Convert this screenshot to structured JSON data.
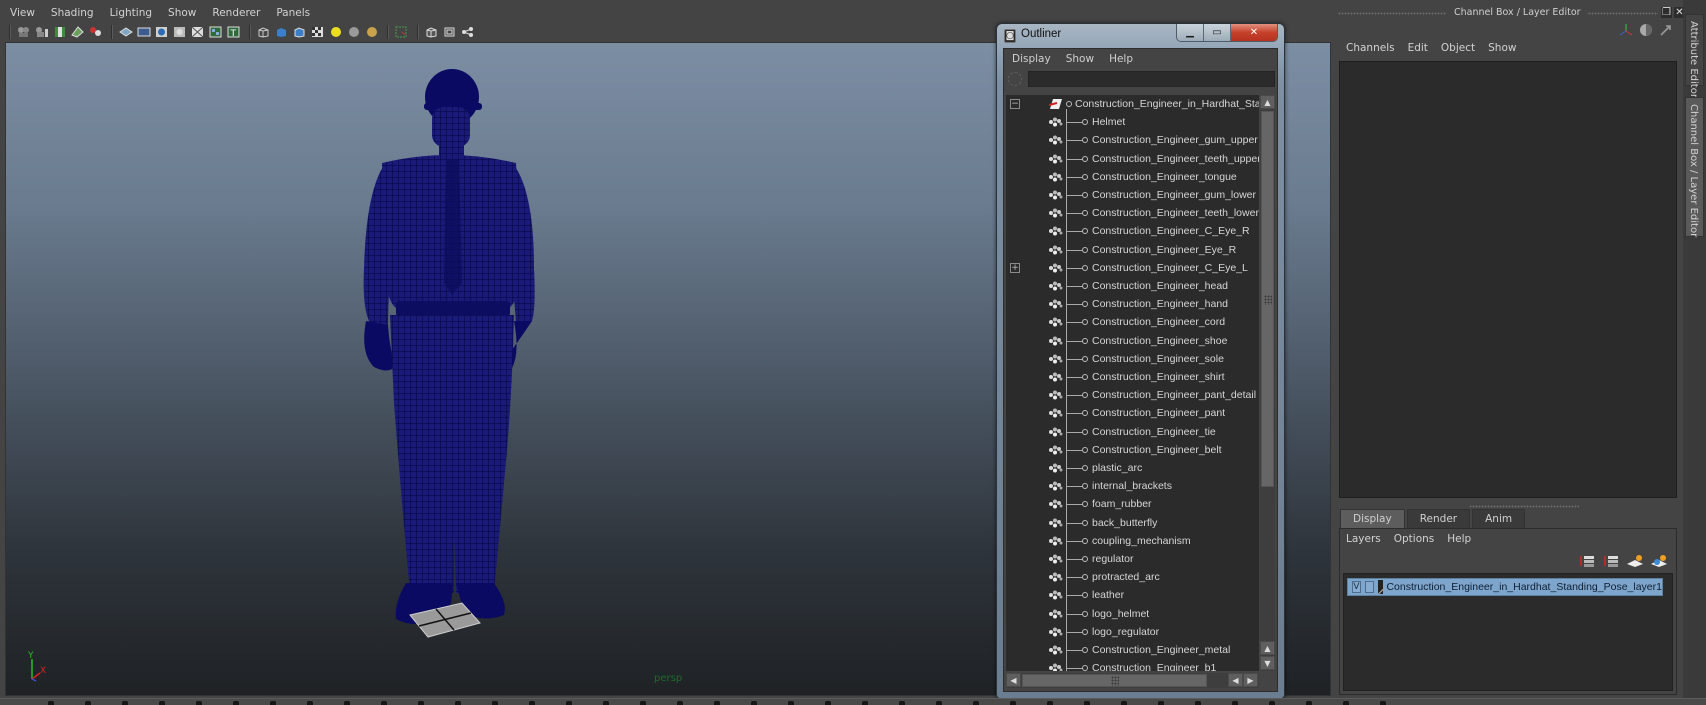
{
  "viewport": {
    "menu": [
      "View",
      "Shading",
      "Lighting",
      "Show",
      "Renderer",
      "Panels"
    ],
    "toolbar_icons": [
      "camera-select-icon",
      "camera-attributes-icon",
      "bookmark-icon",
      "image-plane-icon",
      "2d-pan-zoom-icon",
      "grid-icon",
      "film-gate-icon",
      "resolution-gate-icon",
      "gate-mask-icon",
      "field-chart-icon",
      "safe-action-icon",
      "safe-title-icon",
      "wireframe-icon",
      "smooth-shade-icon",
      "wireframe-on-shaded-icon",
      "textured-icon",
      "use-all-lights-icon",
      "shadows-icon",
      "ambient-occlusion-icon",
      "isolate-select-icon",
      "xray-icon",
      "xray-joints-icon",
      "xray-component-icon"
    ],
    "camera_label": "persp",
    "axis": {
      "y": "Y",
      "x": "X"
    },
    "wireframe_color": "#0a0a6e",
    "background_top": "#7c8ea3",
    "background_bottom": "#1f2225"
  },
  "outliner": {
    "title": "Outliner",
    "menu": [
      "Display",
      "Show",
      "Help"
    ],
    "search_value": "",
    "root": {
      "label": "Construction_Engineer_in_Hardhat_Standin",
      "expanded": true
    },
    "items": [
      {
        "label": "Helmet",
        "expandable": false
      },
      {
        "label": "Construction_Engineer_gum_upper",
        "expandable": false
      },
      {
        "label": "Construction_Engineer_teeth_upper",
        "expandable": false
      },
      {
        "label": "Construction_Engineer_tongue",
        "expandable": false
      },
      {
        "label": "Construction_Engineer_gum_lower",
        "expandable": false
      },
      {
        "label": "Construction_Engineer_teeth_lower",
        "expandable": false
      },
      {
        "label": "Construction_Engineer_C_Eye_R",
        "expandable": false
      },
      {
        "label": "Construction_Engineer_Eye_R",
        "expandable": false
      },
      {
        "label": "Construction_Engineer_C_Eye_L",
        "expandable": true
      },
      {
        "label": "Construction_Engineer_head",
        "expandable": false
      },
      {
        "label": "Construction_Engineer_hand",
        "expandable": false
      },
      {
        "label": "Construction_Engineer_cord",
        "expandable": false
      },
      {
        "label": "Construction_Engineer_shoe",
        "expandable": false
      },
      {
        "label": "Construction_Engineer_sole",
        "expandable": false
      },
      {
        "label": "Construction_Engineer_shirt",
        "expandable": false
      },
      {
        "label": "Construction_Engineer_pant_detail",
        "expandable": false
      },
      {
        "label": "Construction_Engineer_pant",
        "expandable": false
      },
      {
        "label": "Construction_Engineer_tie",
        "expandable": false
      },
      {
        "label": "Construction_Engineer_belt",
        "expandable": false
      },
      {
        "label": "plastic_arc",
        "expandable": false
      },
      {
        "label": "internal_brackets",
        "expandable": false
      },
      {
        "label": "foam_rubber",
        "expandable": false
      },
      {
        "label": "back_butterfly",
        "expandable": false
      },
      {
        "label": "coupling_mechanism",
        "expandable": false
      },
      {
        "label": "regulator",
        "expandable": false
      },
      {
        "label": "protracted_arc",
        "expandable": false
      },
      {
        "label": "leather",
        "expandable": false
      },
      {
        "label": "logo_helmet",
        "expandable": false
      },
      {
        "label": "logo_regulator",
        "expandable": false
      },
      {
        "label": "Construction_Engineer_metal",
        "expandable": false
      },
      {
        "label": "Construction_Engineer_b1",
        "expandable": false
      }
    ]
  },
  "channel_box": {
    "title": "Channel Box / Layer Editor",
    "menu": [
      "Channels",
      "Edit",
      "Object",
      "Show"
    ]
  },
  "layer_editor": {
    "tabs": [
      "Display",
      "Render",
      "Anim"
    ],
    "active_tab": "Display",
    "menu": [
      "Layers",
      "Options",
      "Help"
    ],
    "layers": [
      {
        "visible": "V",
        "playback": "",
        "name": "Construction_Engineer_in_Hardhat_Standing_Pose_layer1",
        "selected": true
      }
    ],
    "selected_color": "#7ea5cc"
  },
  "side_tabs": [
    "Attribute Editor",
    "Channel Box / Layer Editor"
  ],
  "active_side_tab": "Channel Box / Layer Editor"
}
